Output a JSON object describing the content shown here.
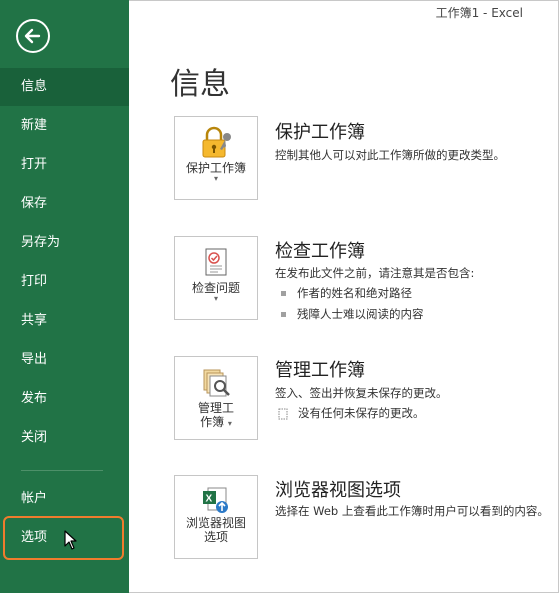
{
  "window": {
    "title": "工作簿1 - Excel"
  },
  "sidebar": {
    "items": [
      {
        "label": "信息"
      },
      {
        "label": "新建"
      },
      {
        "label": "打开"
      },
      {
        "label": "保存"
      },
      {
        "label": "另存为"
      },
      {
        "label": "打印"
      },
      {
        "label": "共享"
      },
      {
        "label": "导出"
      },
      {
        "label": "发布"
      },
      {
        "label": "关闭"
      },
      {
        "label": "帐户"
      },
      {
        "label": "选项"
      }
    ],
    "active_index": 0
  },
  "main": {
    "title": "信息",
    "sections": [
      {
        "button_label": "保护工作簿",
        "title": "保护工作簿",
        "description": "控制其他人可以对此工作簿所做的更改类型。"
      },
      {
        "button_label": "检查问题",
        "title": "检查工作簿",
        "description": "在发布此文件之前，请注意其是否包含:",
        "bullets": [
          "作者的姓名和绝对路径",
          "残障人士难以阅读的内容"
        ]
      },
      {
        "button_label_line1": "管理工",
        "button_label_line2": "作簿",
        "title": "管理工作簿",
        "description": "签入、签出并恢复未保存的更改。",
        "bullets": [
          "没有任何未保存的更改。"
        ]
      },
      {
        "button_label_line1": "浏览器视图",
        "button_label_line2": "选项",
        "title": "浏览器视图选项",
        "description": "选择在 Web 上查看此工作簿时用户可以看到的内容。"
      }
    ]
  },
  "colors": {
    "sidebar_bg": "#217346",
    "sidebar_active": "#19613a",
    "highlight": "#f07c2d"
  }
}
